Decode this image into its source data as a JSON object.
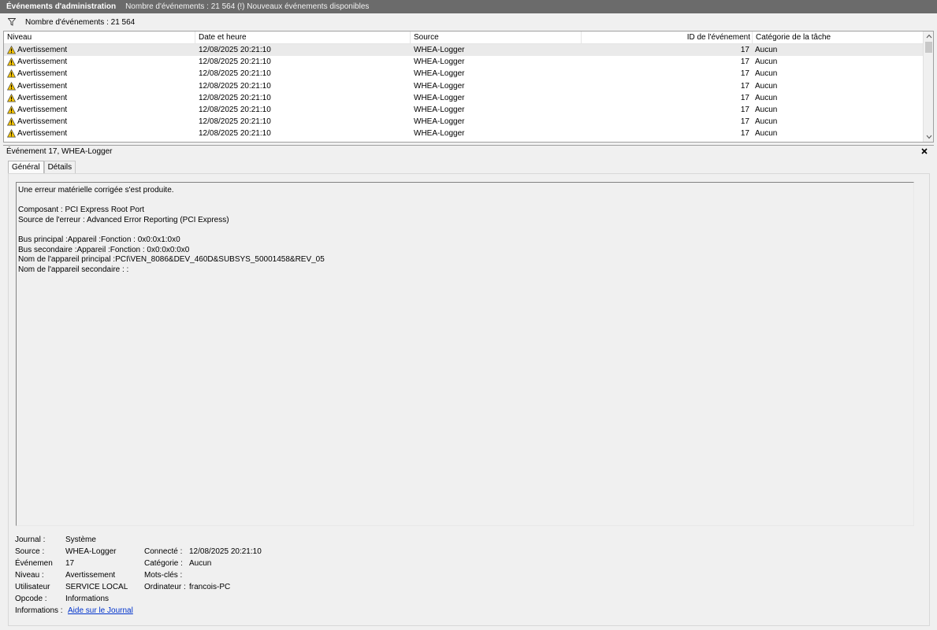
{
  "title_bar": {
    "title": "Événements d'administration",
    "status": "Nombre d'événements : 21 564 (!) Nouveaux événements disponibles"
  },
  "filter_bar": {
    "icon": "filter-icon",
    "count_text": "Nombre d'événements : 21 564"
  },
  "grid": {
    "columns": [
      "Niveau",
      "Date et heure",
      "Source",
      "ID de l'événement",
      "Catégorie de la tâche"
    ],
    "rows": [
      {
        "level": "Avertissement",
        "date": "12/08/2025 20:21:10",
        "source": "WHEA-Logger",
        "id": "17",
        "category": "Aucun"
      },
      {
        "level": "Avertissement",
        "date": "12/08/2025 20:21:10",
        "source": "WHEA-Logger",
        "id": "17",
        "category": "Aucun"
      },
      {
        "level": "Avertissement",
        "date": "12/08/2025 20:21:10",
        "source": "WHEA-Logger",
        "id": "17",
        "category": "Aucun"
      },
      {
        "level": "Avertissement",
        "date": "12/08/2025 20:21:10",
        "source": "WHEA-Logger",
        "id": "17",
        "category": "Aucun"
      },
      {
        "level": "Avertissement",
        "date": "12/08/2025 20:21:10",
        "source": "WHEA-Logger",
        "id": "17",
        "category": "Aucun"
      },
      {
        "level": "Avertissement",
        "date": "12/08/2025 20:21:10",
        "source": "WHEA-Logger",
        "id": "17",
        "category": "Aucun"
      },
      {
        "level": "Avertissement",
        "date": "12/08/2025 20:21:10",
        "source": "WHEA-Logger",
        "id": "17",
        "category": "Aucun"
      },
      {
        "level": "Avertissement",
        "date": "12/08/2025 20:21:10",
        "source": "WHEA-Logger",
        "id": "17",
        "category": "Aucun"
      }
    ]
  },
  "detail": {
    "header": "Événement 17, WHEA-Logger",
    "tabs": [
      "Général",
      "Détails"
    ],
    "message_lines": [
      "Une erreur matérielle corrigée s'est produite.",
      "",
      "Composant : PCI Express Root Port",
      "Source de l'erreur : Advanced Error Reporting (PCI Express)",
      "",
      "Bus principal :Appareil :Fonction : 0x0:0x1:0x0",
      "Bus secondaire :Appareil :Fonction : 0x0:0x0:0x0",
      "Nom de l'appareil principal :PCI\\VEN_8086&DEV_460D&SUBSYS_50001458&REV_05",
      "Nom de l'appareil secondaire : :"
    ],
    "properties": {
      "journal": {
        "label": "Journal :",
        "value": "Système"
      },
      "source": {
        "label": "Source :",
        "value": "WHEA-Logger"
      },
      "event_id": {
        "label": "Événemen",
        "value": "17"
      },
      "level": {
        "label": "Niveau :",
        "value": "Avertissement"
      },
      "user": {
        "label": "Utilisateur",
        "value": "SERVICE LOCAL"
      },
      "opcode": {
        "label": "Opcode :",
        "value": "Informations"
      },
      "info": {
        "label": "Informations :",
        "link": "Aide sur le Journal"
      },
      "logged": {
        "label": "Connecté :",
        "value": "12/08/2025 20:21:10"
      },
      "category": {
        "label": "Catégorie :",
        "value": "Aucun"
      },
      "keywords": {
        "label": "Mots-clés :",
        "value": ""
      },
      "computer": {
        "label": "Ordinateur :",
        "value": "francois-PC"
      }
    }
  },
  "colors": {
    "title_bar_bg": "#6b6b6b",
    "selected_row_bg": "#eaeaea",
    "link": "#0033cc",
    "warning_fill": "#f5c400"
  }
}
